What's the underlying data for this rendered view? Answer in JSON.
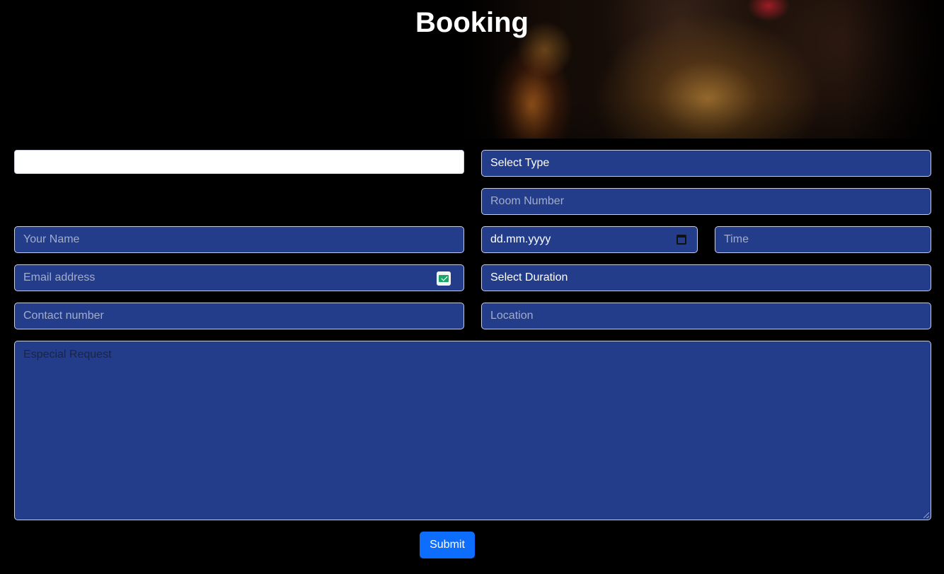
{
  "header": {
    "title": "Booking"
  },
  "form": {
    "type_select": {
      "value": "Select Type"
    },
    "room_number": {
      "placeholder": "Room Number"
    },
    "name": {
      "placeholder": "Your Name"
    },
    "date": {
      "value": "dd.mm.yyyy"
    },
    "time": {
      "placeholder": "Time"
    },
    "email": {
      "placeholder": "Email address"
    },
    "duration_select": {
      "value": "Select Duration"
    },
    "contact": {
      "placeholder": "Contact number"
    },
    "location": {
      "placeholder": "Location"
    },
    "special_request": {
      "placeholder": "Especial Request"
    },
    "submit_label": "Submit"
  },
  "icons": {
    "email_autofill": "email-autofill-icon",
    "calendar": "calendar-icon"
  },
  "colors": {
    "background": "#000000",
    "field_fill": "#233d8a",
    "field_border": "#c9cde0",
    "placeholder": "#a3acc9",
    "submit": "#0d6efd"
  }
}
